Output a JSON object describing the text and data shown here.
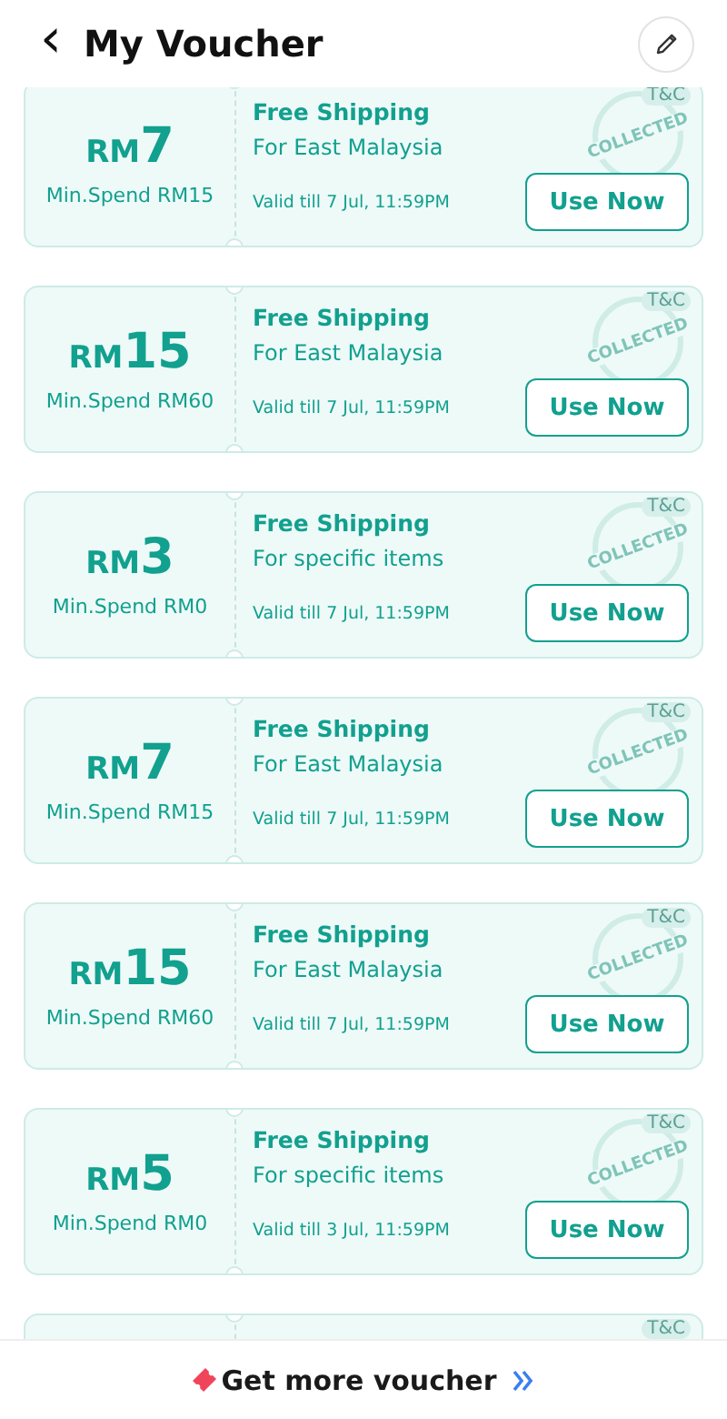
{
  "header": {
    "back": "‹",
    "title": "My Voucher"
  },
  "vouchers": [
    {
      "currency": "RM",
      "amount": "7",
      "min_spend": "Min.Spend RM15",
      "title": "Free Shipping",
      "subtitle": "For East Malaysia",
      "validity": "Valid till 7 Jul, 11:59PM",
      "tc": "T&C",
      "stamp": "COLLECTED",
      "button": "Use Now"
    },
    {
      "currency": "RM",
      "amount": "15",
      "min_spend": "Min.Spend RM60",
      "title": "Free Shipping",
      "subtitle": "For East Malaysia",
      "validity": "Valid till 7 Jul, 11:59PM",
      "tc": "T&C",
      "stamp": "COLLECTED",
      "button": "Use Now"
    },
    {
      "currency": "RM",
      "amount": "3",
      "min_spend": "Min.Spend RM0",
      "title": "Free Shipping",
      "subtitle": "For specific items",
      "validity": "Valid till 7 Jul, 11:59PM",
      "tc": "T&C",
      "stamp": "COLLECTED",
      "button": "Use Now"
    },
    {
      "currency": "RM",
      "amount": "7",
      "min_spend": "Min.Spend RM15",
      "title": "Free Shipping",
      "subtitle": "For East Malaysia",
      "validity": "Valid till 7 Jul, 11:59PM",
      "tc": "T&C",
      "stamp": "COLLECTED",
      "button": "Use Now"
    },
    {
      "currency": "RM",
      "amount": "15",
      "min_spend": "Min.Spend RM60",
      "title": "Free Shipping",
      "subtitle": "For East Malaysia",
      "validity": "Valid till 7 Jul, 11:59PM",
      "tc": "T&C",
      "stamp": "COLLECTED",
      "button": "Use Now"
    },
    {
      "currency": "RM",
      "amount": "5",
      "min_spend": "Min.Spend RM0",
      "title": "Free Shipping",
      "subtitle": "For specific items",
      "validity": "Valid till 3 Jul, 11:59PM",
      "tc": "T&C",
      "stamp": "COLLECTED",
      "button": "Use Now"
    },
    {
      "tc": "T&C"
    }
  ],
  "footer": {
    "label": "Get more voucher"
  }
}
